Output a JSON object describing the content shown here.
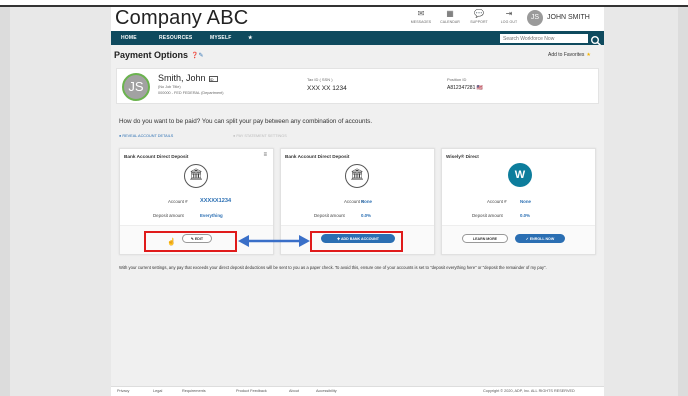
{
  "header": {
    "company": "Company ABC",
    "icons": [
      {
        "name": "messages-icon",
        "glyph": "✉",
        "label": "MESSAGES"
      },
      {
        "name": "calendar-icon",
        "glyph": "▦",
        "label": "CALENDAR"
      },
      {
        "name": "support-icon",
        "glyph": "💬",
        "label": "SUPPORT"
      },
      {
        "name": "logout-icon",
        "glyph": "⇥",
        "label": "LOG OUT"
      }
    ],
    "avatar_initials": "JS",
    "username": "JOHN SMITH"
  },
  "nav": {
    "items": [
      "HOME",
      "RESOURCES",
      "MYSELF",
      "★"
    ],
    "search_placeholder": "Search Workforce Now",
    "search_icon": "🔍"
  },
  "page": {
    "title": "Payment Options",
    "title_icons": "❓✎",
    "favorites": "Add to Favorites",
    "favorites_star": "★"
  },
  "profile": {
    "initials": "JS",
    "name": "Smith, John",
    "badge": "ID",
    "job_title": "(No Job Title)",
    "department": "000000 - FED FEDERAL (Department)",
    "tax_label": "Tax ID ( SSN )",
    "tax_value": "XXX XX 1234",
    "position_label": "Position ID",
    "position_value": "A812347281",
    "flag": "🇺🇸"
  },
  "question": "How do you want to be paid? You can split your pay between any combination of accounts.",
  "reveal_link": "● REVEAL ACCOUNT DETAILS",
  "reveal_link2": "● PAY STATEMENT SETTINGS",
  "cards": [
    {
      "title": "Bank Account Direct Deposit",
      "menu": "≡",
      "icon": "🏛",
      "account_label": "Account #",
      "account_value": "XXXXX1234",
      "deposit_label": "Deposit amount",
      "deposit_value": "Everything",
      "button": "✎ EDIT"
    },
    {
      "title": "Bank Account Direct Deposit",
      "icon": "🏛",
      "account_label": "Account #",
      "account_value": "None",
      "deposit_label": "Deposit amount",
      "deposit_value": "0.0%",
      "button": "✚ ADD BANK ACCOUNT"
    },
    {
      "title": "Wisely® Direct",
      "icon": "W",
      "account_label": "Account #",
      "account_value": "None",
      "deposit_label": "Deposit amount",
      "deposit_value": "0.0%",
      "button_learn": "LEARN MORE",
      "button_enroll": "✓ ENROLL NOW"
    }
  ],
  "notice": "With your current settings, any pay that exceeds your direct deposit deductions will be sent to you as a paper check. To avoid this, ensure one of your accounts is set to \"deposit everything here\" or \"deposit the remainder of my pay\".",
  "footer": {
    "links": [
      "Privacy",
      "Legal",
      "Requirements",
      "Product Feedback",
      "About",
      "Accessibility"
    ],
    "copyright": "Copyright © 2020, ADP, Inc. ALL RIGHTS RESERVED"
  },
  "colors": {
    "nav": "#0f4a5e",
    "accent": "#2b6fb3",
    "highlight": "#e01b1b",
    "wisely": "#0d7d9c"
  }
}
